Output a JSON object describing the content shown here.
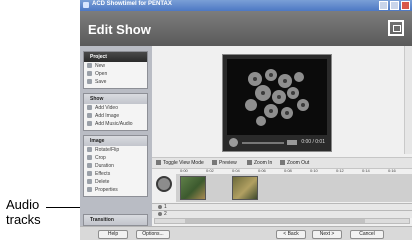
{
  "annotation": {
    "line1": "Audio",
    "line2": "tracks"
  },
  "window": {
    "title": "ACD ShowtimeI for PENTAX"
  },
  "header": {
    "title": "Edit Show",
    "icon": "show-frame-icon"
  },
  "sidebar": {
    "project": {
      "title": "Project",
      "items": [
        "New",
        "Open",
        "Save"
      ]
    },
    "show": {
      "title": "Show",
      "items": [
        "Add Video",
        "Add Image",
        "Add Music/Audio"
      ]
    },
    "image": {
      "title": "Image",
      "items": [
        "Rotate/Flip",
        "Crop",
        "Duration",
        "Effects",
        "Delete",
        "Properties"
      ]
    },
    "transition": {
      "title": "Transition"
    }
  },
  "preview": {
    "time": "0:00 / 0:01"
  },
  "toolbar": {
    "toggle": "Toggle View Mode",
    "preview": "Preview",
    "zoom_in": "Zoom In",
    "zoom_out": "Zoom Out"
  },
  "timeline": {
    "ticks": [
      "0:00",
      "0:02",
      "0:04",
      "0:06",
      "0:08",
      "0:10",
      "0:12",
      "0:14",
      "0:16"
    ],
    "audio_tracks": [
      "1",
      "2"
    ]
  },
  "footer": {
    "help": "Help",
    "options": "Options...",
    "back": "< Back",
    "next": "Next >",
    "cancel": "Cancel"
  },
  "colors": {
    "header_bg": "#6b6b6b",
    "titlebar": "#4d78c4",
    "sidebar_bg": "#b9bcc4"
  }
}
